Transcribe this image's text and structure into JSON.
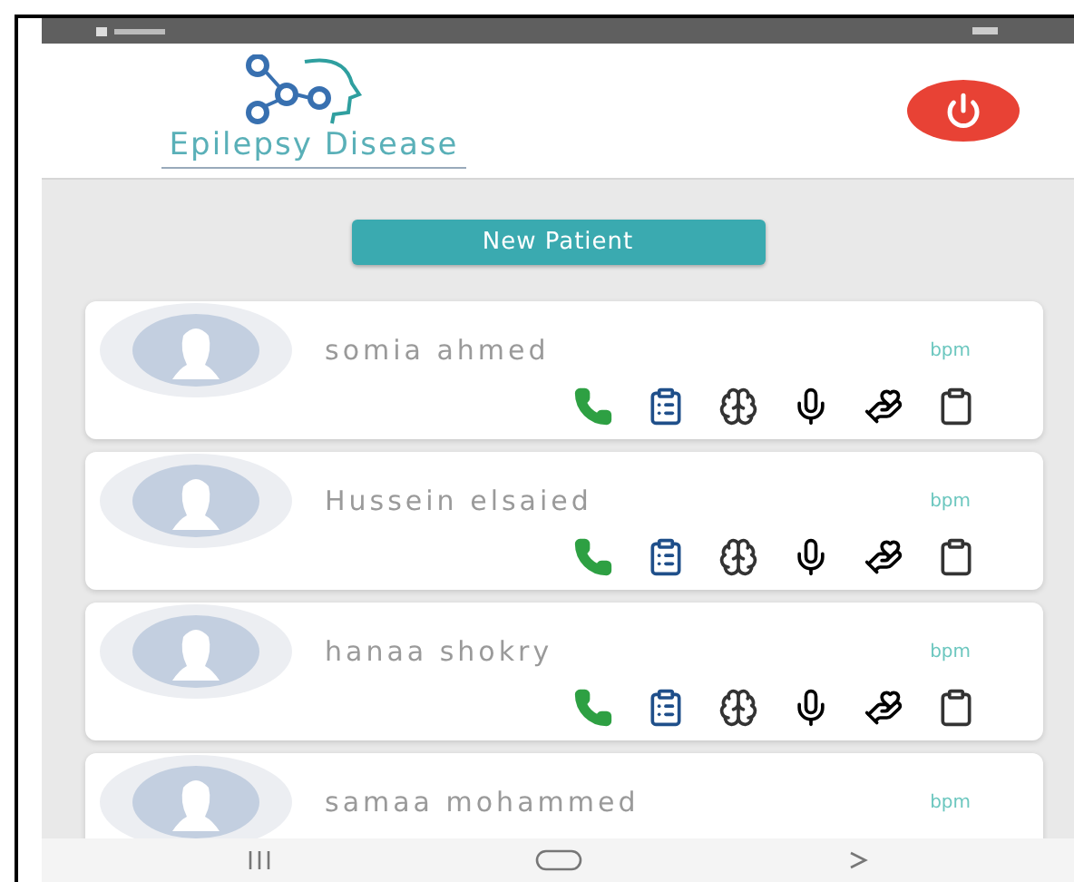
{
  "header": {
    "logo_text": "Epilepsy Disease"
  },
  "new_patient_button": "New Patient",
  "patients": [
    {
      "kind": "full",
      "name": "somia ahmed",
      "reading": "bpm"
    },
    {
      "kind": "full",
      "name": "Hussein elsaied",
      "reading": "bpm"
    },
    {
      "kind": "full",
      "name": "hanaa shokry",
      "reading": "bpm"
    },
    {
      "kind": "cut",
      "name": "samaa mohammed",
      "reading": "bpm"
    }
  ]
}
